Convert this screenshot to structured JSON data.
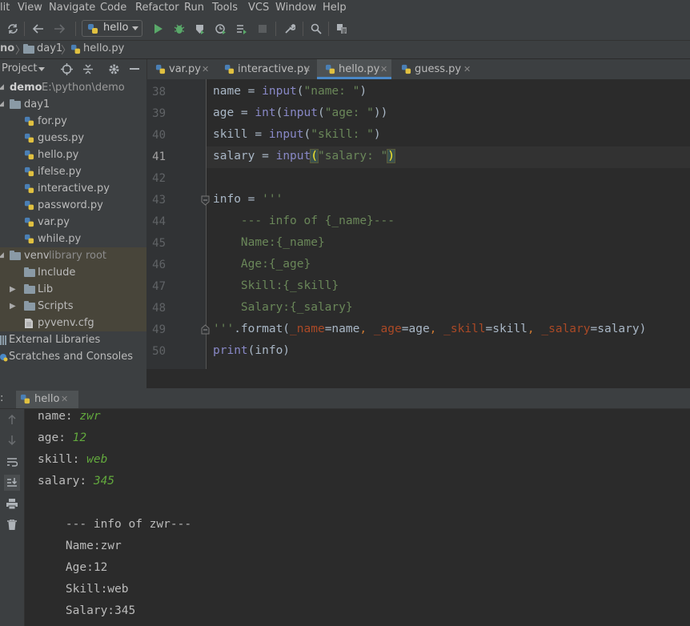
{
  "menu": [
    "lit",
    "View",
    "Navigate",
    "Code",
    "Refactor",
    "Run",
    "Tools",
    "VCS",
    "Window",
    "Help"
  ],
  "toolbar": {
    "run_config": "hello"
  },
  "breadcrumb": {
    "project": "no",
    "folder": "day1",
    "file": "hello.py"
  },
  "project_panel": {
    "title": "Project",
    "root_name": "demo",
    "root_path": "E:\\python\\demo",
    "folder": "day1",
    "files": [
      "for.py",
      "guess.py",
      "hello.py",
      "ifelse.py",
      "interactive.py",
      "password.py",
      "var.py",
      "while.py"
    ],
    "venv_name": "venv",
    "venv_note": "library root",
    "venv_children": [
      "Include",
      "Lib",
      "Scripts"
    ],
    "venv_file": "pyvenv.cfg",
    "external": "External Libraries",
    "scratches": "Scratches and Consoles"
  },
  "editor_tabs": [
    "var.py",
    "interactive.py",
    "hello.py",
    "guess.py"
  ],
  "active_tab": "hello.py",
  "code": {
    "line_numbers": [
      "38",
      "39",
      "40",
      "41",
      "42",
      "43",
      "44",
      "45",
      "46",
      "47",
      "48",
      "49",
      "50"
    ],
    "l38": [
      "name",
      " = ",
      "input",
      "(",
      "\"name: \"",
      ")"
    ],
    "l39": [
      "age",
      " = ",
      "int",
      "(",
      "input",
      "(",
      "\"age: \"",
      "))"
    ],
    "l40": [
      "skill",
      " = ",
      "input",
      "(",
      "\"skill: \"",
      ")"
    ],
    "l41": [
      "salary",
      " = ",
      "input",
      "(",
      "\"salary: \"",
      ")"
    ],
    "l43": [
      "info = ",
      "'''"
    ],
    "l44": "    --- info of {_name}---",
    "l45": "    Name:{_name}",
    "l46": "    Age:{_age}",
    "l47": "    Skill:{_skill}",
    "l48": "    Salary:{_salary}",
    "l49": [
      "'''",
      ".format(",
      "_name",
      "=name",
      ", ",
      "_age",
      "=age",
      ", ",
      "_skill",
      "=skill",
      ", ",
      "_salary",
      "=salary)"
    ],
    "l50": [
      "print",
      "(info)"
    ]
  },
  "run_panel": {
    "tab": "hello",
    "prompts": [
      {
        "label": "name: ",
        "input": "zwr"
      },
      {
        "label": "age: ",
        "input": "12"
      },
      {
        "label": "skill: ",
        "input": "web"
      },
      {
        "label": "salary: ",
        "input": "345"
      }
    ],
    "output": [
      "    --- info of zwr---",
      "    Name:zwr",
      "    Age:12",
      "    Skill:web",
      "    Salary:345"
    ]
  }
}
